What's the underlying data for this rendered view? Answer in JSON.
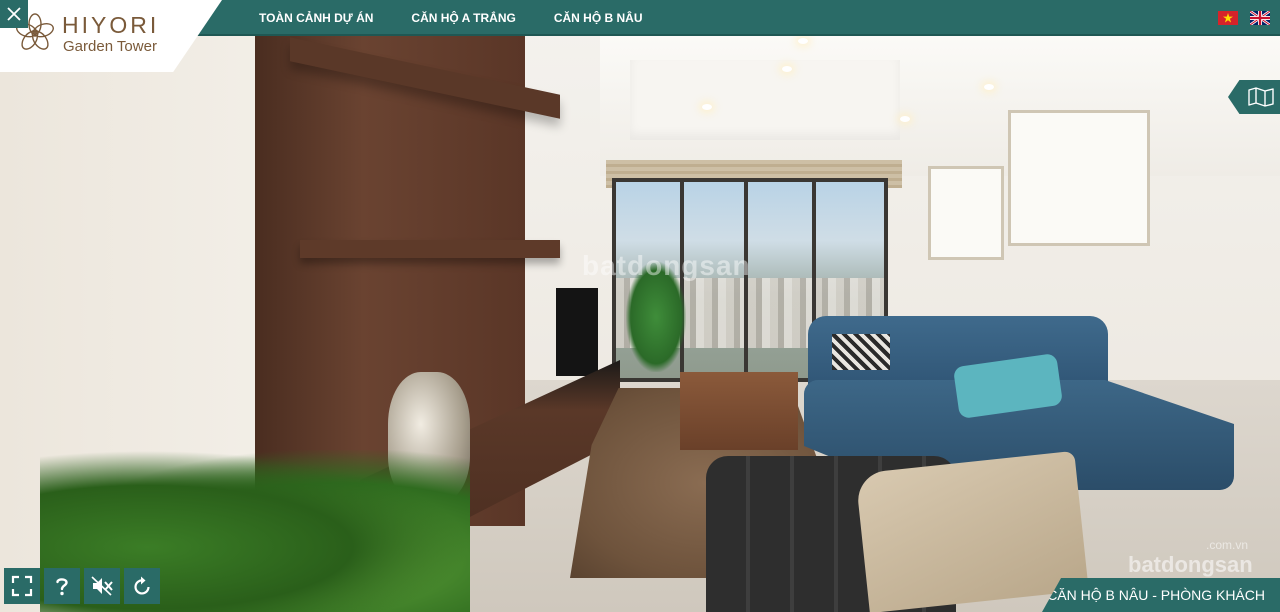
{
  "brand": {
    "name": "HIYORI",
    "subtitle": "Garden Tower"
  },
  "nav": {
    "items": [
      {
        "label": "TOÀN CẢNH DỰ ÁN"
      },
      {
        "label": "CĂN HỘ A TRẮNG"
      },
      {
        "label": "CĂN HỘ B NÂU"
      }
    ]
  },
  "languages": [
    {
      "code": "vi",
      "icon": "vietnam-flag-icon"
    },
    {
      "code": "en",
      "icon": "uk-flag-icon"
    }
  ],
  "controls": [
    {
      "icon": "fullscreen-icon"
    },
    {
      "icon": "help-icon"
    },
    {
      "icon": "mute-icon"
    },
    {
      "icon": "auto-rotate-icon"
    }
  ],
  "caption": "CĂN HỘ B NÂU - PHÒNG KHÁCH",
  "watermarks": {
    "center": "batdongsan",
    "corner": "batdongsan",
    "corner_suffix": ".com.vn"
  },
  "colors": {
    "accent": "#2a6b67",
    "brand_text": "#7a5a3a"
  }
}
